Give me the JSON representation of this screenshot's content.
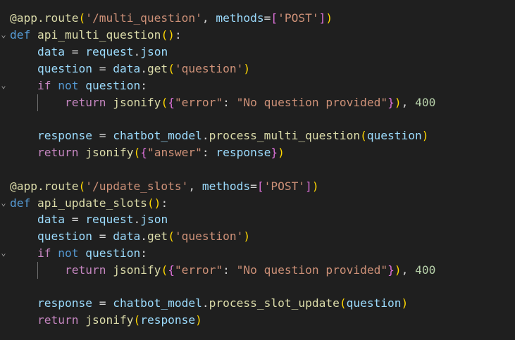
{
  "editor": {
    "lines": [
      {
        "fold": "",
        "tokens": [
          [
            "@app.route",
            "dec"
          ],
          [
            "(",
            "b1"
          ],
          [
            "'/multi_question'",
            "str"
          ],
          [
            ", ",
            "pl"
          ],
          [
            "methods",
            "var"
          ],
          [
            "=",
            "pl"
          ],
          [
            "[",
            "b2"
          ],
          [
            "'POST'",
            "str"
          ],
          [
            "]",
            "b2"
          ],
          [
            ")",
            "b1"
          ]
        ]
      },
      {
        "fold": "⌄",
        "tokens": [
          [
            "def",
            "kw"
          ],
          [
            " ",
            "pl"
          ],
          [
            "api_multi_question",
            "fn"
          ],
          [
            "()",
            "b1"
          ],
          [
            ":",
            "pl"
          ]
        ]
      },
      {
        "fold": "",
        "tokens": [
          [
            "    ",
            "pl"
          ],
          [
            "data",
            "var"
          ],
          [
            " = ",
            "pl"
          ],
          [
            "request",
            "var"
          ],
          [
            ".",
            "pl"
          ],
          [
            "json",
            "var"
          ]
        ]
      },
      {
        "fold": "",
        "tokens": [
          [
            "    ",
            "pl"
          ],
          [
            "question",
            "var"
          ],
          [
            " = ",
            "pl"
          ],
          [
            "data",
            "var"
          ],
          [
            ".",
            "pl"
          ],
          [
            "get",
            "fn"
          ],
          [
            "(",
            "b1"
          ],
          [
            "'question'",
            "str"
          ],
          [
            ")",
            "b1"
          ]
        ]
      },
      {
        "fold": "⌄",
        "tokens": [
          [
            "    ",
            "pl"
          ],
          [
            "if",
            "ctl"
          ],
          [
            " ",
            "pl"
          ],
          [
            "not",
            "kw"
          ],
          [
            " ",
            "pl"
          ],
          [
            "question",
            "var"
          ],
          [
            ":",
            "pl"
          ]
        ]
      },
      {
        "fold": "",
        "tokens": [
          [
            "        ",
            "pl"
          ],
          [
            "return",
            "ctl"
          ],
          [
            " ",
            "pl"
          ],
          [
            "jsonify",
            "fn"
          ],
          [
            "(",
            "b1"
          ],
          [
            "{",
            "b2"
          ],
          [
            "\"error\"",
            "str"
          ],
          [
            ": ",
            "pl"
          ],
          [
            "\"No question provided\"",
            "str"
          ],
          [
            "}",
            "b2"
          ],
          [
            ")",
            "b1"
          ],
          [
            ", ",
            "pl"
          ],
          [
            "400",
            "num"
          ]
        ]
      },
      {
        "fold": "",
        "tokens": []
      },
      {
        "fold": "",
        "tokens": [
          [
            "    ",
            "pl"
          ],
          [
            "response",
            "var"
          ],
          [
            " = ",
            "pl"
          ],
          [
            "chatbot_model",
            "var"
          ],
          [
            ".",
            "pl"
          ],
          [
            "process_multi_question",
            "fn"
          ],
          [
            "(",
            "b1"
          ],
          [
            "question",
            "var"
          ],
          [
            ")",
            "b1"
          ]
        ]
      },
      {
        "fold": "",
        "tokens": [
          [
            "    ",
            "pl"
          ],
          [
            "return",
            "ctl"
          ],
          [
            " ",
            "pl"
          ],
          [
            "jsonify",
            "fn"
          ],
          [
            "(",
            "b1"
          ],
          [
            "{",
            "b2"
          ],
          [
            "\"answer\"",
            "str"
          ],
          [
            ": ",
            "pl"
          ],
          [
            "response",
            "var"
          ],
          [
            "}",
            "b2"
          ],
          [
            ")",
            "b1"
          ]
        ]
      },
      {
        "fold": "",
        "tokens": []
      },
      {
        "fold": "",
        "tokens": [
          [
            "@app.route",
            "dec"
          ],
          [
            "(",
            "b1"
          ],
          [
            "'/update_slots'",
            "str"
          ],
          [
            ", ",
            "pl"
          ],
          [
            "methods",
            "var"
          ],
          [
            "=",
            "pl"
          ],
          [
            "[",
            "b2"
          ],
          [
            "'POST'",
            "str"
          ],
          [
            "]",
            "b2"
          ],
          [
            ")",
            "b1"
          ]
        ]
      },
      {
        "fold": "⌄",
        "tokens": [
          [
            "def",
            "kw"
          ],
          [
            " ",
            "pl"
          ],
          [
            "api_update_slots",
            "fn"
          ],
          [
            "()",
            "b1"
          ],
          [
            ":",
            "pl"
          ]
        ]
      },
      {
        "fold": "",
        "tokens": [
          [
            "    ",
            "pl"
          ],
          [
            "data",
            "var"
          ],
          [
            " = ",
            "pl"
          ],
          [
            "request",
            "var"
          ],
          [
            ".",
            "pl"
          ],
          [
            "json",
            "var"
          ]
        ]
      },
      {
        "fold": "",
        "tokens": [
          [
            "    ",
            "pl"
          ],
          [
            "question",
            "var"
          ],
          [
            " = ",
            "pl"
          ],
          [
            "data",
            "var"
          ],
          [
            ".",
            "pl"
          ],
          [
            "get",
            "fn"
          ],
          [
            "(",
            "b1"
          ],
          [
            "'question'",
            "str"
          ],
          [
            ")",
            "b1"
          ]
        ]
      },
      {
        "fold": "⌄",
        "tokens": [
          [
            "    ",
            "pl"
          ],
          [
            "if",
            "ctl"
          ],
          [
            " ",
            "pl"
          ],
          [
            "not",
            "kw"
          ],
          [
            " ",
            "pl"
          ],
          [
            "question",
            "var"
          ],
          [
            ":",
            "pl"
          ]
        ]
      },
      {
        "fold": "",
        "tokens": [
          [
            "        ",
            "pl"
          ],
          [
            "return",
            "ctl"
          ],
          [
            " ",
            "pl"
          ],
          [
            "jsonify",
            "fn"
          ],
          [
            "(",
            "b1"
          ],
          [
            "{",
            "b2"
          ],
          [
            "\"error\"",
            "str"
          ],
          [
            ": ",
            "pl"
          ],
          [
            "\"No question provided\"",
            "str"
          ],
          [
            "}",
            "b2"
          ],
          [
            ")",
            "b1"
          ],
          [
            ", ",
            "pl"
          ],
          [
            "400",
            "num"
          ]
        ]
      },
      {
        "fold": "",
        "tokens": []
      },
      {
        "fold": "",
        "tokens": [
          [
            "    ",
            "pl"
          ],
          [
            "response",
            "var"
          ],
          [
            " = ",
            "pl"
          ],
          [
            "chatbot_model",
            "var"
          ],
          [
            ".",
            "pl"
          ],
          [
            "process_slot_update",
            "fn"
          ],
          [
            "(",
            "b1"
          ],
          [
            "question",
            "var"
          ],
          [
            ")",
            "b1"
          ]
        ]
      },
      {
        "fold": "",
        "tokens": [
          [
            "    ",
            "pl"
          ],
          [
            "return",
            "ctl"
          ],
          [
            " ",
            "pl"
          ],
          [
            "jsonify",
            "fn"
          ],
          [
            "(",
            "b1"
          ],
          [
            "response",
            "var"
          ],
          [
            ")",
            "b1"
          ]
        ]
      }
    ],
    "colors": {
      "background": "#1f1f1f",
      "decorator": "#dcdcaa",
      "string": "#ce9178",
      "variable": "#9cdcfe",
      "keyword": "#569cd6",
      "control": "#c586c0",
      "number": "#b5cea8",
      "bracket_1": "#ffd700",
      "bracket_2": "#da70d6"
    }
  }
}
